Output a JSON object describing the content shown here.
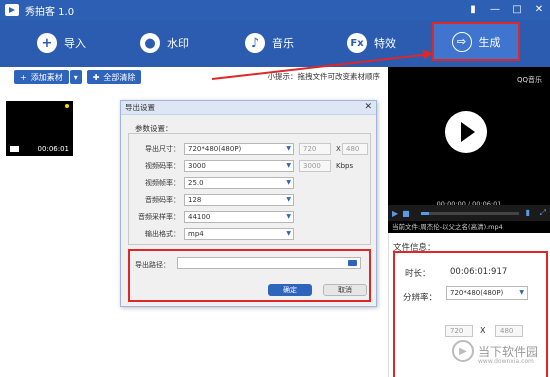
{
  "window": {
    "title": "秀拍客 1.0",
    "controls": [
      "▮",
      "—",
      "□",
      "✕"
    ]
  },
  "toolbar": {
    "import_label": "导入",
    "watermark_label": "水印",
    "music_label": "音乐",
    "effects_label": "特效",
    "generate_label": "生成",
    "effects_icon_text": "Fx"
  },
  "subbar": {
    "add_material_label": "添加素材",
    "clear_all_label": "全部清除",
    "tip": "小提示：拖拽文件可改变素材顺序"
  },
  "media": {
    "thumb_time": "00:06:01"
  },
  "dialog": {
    "title": "导出设置",
    "section_label": "参数设置：",
    "rows": [
      {
        "label": "导出尺寸：",
        "value": "720*480(480P)"
      },
      {
        "label": "视频码率：",
        "value": "3000"
      },
      {
        "label": "视频帧率：",
        "value": "25.0"
      },
      {
        "label": "音频码率：",
        "value": "128"
      },
      {
        "label": "音频采样率：",
        "value": "44100"
      },
      {
        "label": "输出格式：",
        "value": "mp4"
      }
    ],
    "width_value": "720",
    "x_sep": "X",
    "height_value": "480",
    "kbps_value": "3000",
    "kbps_unit": "Kbps",
    "path_label": "导出路径：",
    "ok_label": "确定",
    "cancel_label": "取消"
  },
  "preview": {
    "logo_text": "QQ音乐",
    "time": "00:00:00 / 00:06:01",
    "filename": "当前文件:周杰伦-以父之名(高清).mp4"
  },
  "info": {
    "title": "文件信息：",
    "duration_label": "时长：",
    "duration_value": "00:06:01:917",
    "resolution_label": "分辨率：",
    "resolution_value": "720*480(480P)",
    "width_value": "720",
    "x_sep": "X",
    "height_value": "480"
  },
  "watermark_site": {
    "text": "当下软件园",
    "url": "www.downxia.com"
  },
  "colors": {
    "titlebar": "#2d5fb4",
    "toolbar": "#2b5cb0",
    "highlight": "#e02727",
    "button": "#2f64bd"
  }
}
